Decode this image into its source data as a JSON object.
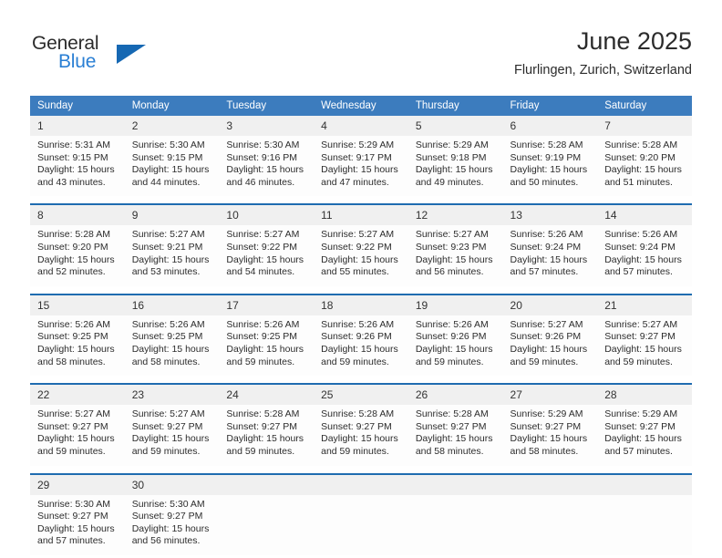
{
  "brand": {
    "name_part1": "General",
    "name_part2": "Blue",
    "logo_icon": "triangle-icon"
  },
  "header": {
    "title": "June 2025",
    "subtitle": "Flurlingen, Zurich, Switzerland"
  },
  "colors": {
    "header_blue": "#3c7cbe",
    "separator_blue": "#1f6cb0",
    "daynum_band": "#f0f0f0",
    "brand_blue": "#2a7fd4",
    "text": "#2c2c2c"
  },
  "day_headers": [
    "Sunday",
    "Monday",
    "Tuesday",
    "Wednesday",
    "Thursday",
    "Friday",
    "Saturday"
  ],
  "weeks": [
    {
      "days": [
        {
          "num": "1",
          "sunrise": "Sunrise: 5:31 AM",
          "sunset": "Sunset: 9:15 PM",
          "daylight_1": "Daylight: 15 hours",
          "daylight_2": "and 43 minutes."
        },
        {
          "num": "2",
          "sunrise": "Sunrise: 5:30 AM",
          "sunset": "Sunset: 9:15 PM",
          "daylight_1": "Daylight: 15 hours",
          "daylight_2": "and 44 minutes."
        },
        {
          "num": "3",
          "sunrise": "Sunrise: 5:30 AM",
          "sunset": "Sunset: 9:16 PM",
          "daylight_1": "Daylight: 15 hours",
          "daylight_2": "and 46 minutes."
        },
        {
          "num": "4",
          "sunrise": "Sunrise: 5:29 AM",
          "sunset": "Sunset: 9:17 PM",
          "daylight_1": "Daylight: 15 hours",
          "daylight_2": "and 47 minutes."
        },
        {
          "num": "5",
          "sunrise": "Sunrise: 5:29 AM",
          "sunset": "Sunset: 9:18 PM",
          "daylight_1": "Daylight: 15 hours",
          "daylight_2": "and 49 minutes."
        },
        {
          "num": "6",
          "sunrise": "Sunrise: 5:28 AM",
          "sunset": "Sunset: 9:19 PM",
          "daylight_1": "Daylight: 15 hours",
          "daylight_2": "and 50 minutes."
        },
        {
          "num": "7",
          "sunrise": "Sunrise: 5:28 AM",
          "sunset": "Sunset: 9:20 PM",
          "daylight_1": "Daylight: 15 hours",
          "daylight_2": "and 51 minutes."
        }
      ]
    },
    {
      "days": [
        {
          "num": "8",
          "sunrise": "Sunrise: 5:28 AM",
          "sunset": "Sunset: 9:20 PM",
          "daylight_1": "Daylight: 15 hours",
          "daylight_2": "and 52 minutes."
        },
        {
          "num": "9",
          "sunrise": "Sunrise: 5:27 AM",
          "sunset": "Sunset: 9:21 PM",
          "daylight_1": "Daylight: 15 hours",
          "daylight_2": "and 53 minutes."
        },
        {
          "num": "10",
          "sunrise": "Sunrise: 5:27 AM",
          "sunset": "Sunset: 9:22 PM",
          "daylight_1": "Daylight: 15 hours",
          "daylight_2": "and 54 minutes."
        },
        {
          "num": "11",
          "sunrise": "Sunrise: 5:27 AM",
          "sunset": "Sunset: 9:22 PM",
          "daylight_1": "Daylight: 15 hours",
          "daylight_2": "and 55 minutes."
        },
        {
          "num": "12",
          "sunrise": "Sunrise: 5:27 AM",
          "sunset": "Sunset: 9:23 PM",
          "daylight_1": "Daylight: 15 hours",
          "daylight_2": "and 56 minutes."
        },
        {
          "num": "13",
          "sunrise": "Sunrise: 5:26 AM",
          "sunset": "Sunset: 9:24 PM",
          "daylight_1": "Daylight: 15 hours",
          "daylight_2": "and 57 minutes."
        },
        {
          "num": "14",
          "sunrise": "Sunrise: 5:26 AM",
          "sunset": "Sunset: 9:24 PM",
          "daylight_1": "Daylight: 15 hours",
          "daylight_2": "and 57 minutes."
        }
      ]
    },
    {
      "days": [
        {
          "num": "15",
          "sunrise": "Sunrise: 5:26 AM",
          "sunset": "Sunset: 9:25 PM",
          "daylight_1": "Daylight: 15 hours",
          "daylight_2": "and 58 minutes."
        },
        {
          "num": "16",
          "sunrise": "Sunrise: 5:26 AM",
          "sunset": "Sunset: 9:25 PM",
          "daylight_1": "Daylight: 15 hours",
          "daylight_2": "and 58 minutes."
        },
        {
          "num": "17",
          "sunrise": "Sunrise: 5:26 AM",
          "sunset": "Sunset: 9:25 PM",
          "daylight_1": "Daylight: 15 hours",
          "daylight_2": "and 59 minutes."
        },
        {
          "num": "18",
          "sunrise": "Sunrise: 5:26 AM",
          "sunset": "Sunset: 9:26 PM",
          "daylight_1": "Daylight: 15 hours",
          "daylight_2": "and 59 minutes."
        },
        {
          "num": "19",
          "sunrise": "Sunrise: 5:26 AM",
          "sunset": "Sunset: 9:26 PM",
          "daylight_1": "Daylight: 15 hours",
          "daylight_2": "and 59 minutes."
        },
        {
          "num": "20",
          "sunrise": "Sunrise: 5:27 AM",
          "sunset": "Sunset: 9:26 PM",
          "daylight_1": "Daylight: 15 hours",
          "daylight_2": "and 59 minutes."
        },
        {
          "num": "21",
          "sunrise": "Sunrise: 5:27 AM",
          "sunset": "Sunset: 9:27 PM",
          "daylight_1": "Daylight: 15 hours",
          "daylight_2": "and 59 minutes."
        }
      ]
    },
    {
      "days": [
        {
          "num": "22",
          "sunrise": "Sunrise: 5:27 AM",
          "sunset": "Sunset: 9:27 PM",
          "daylight_1": "Daylight: 15 hours",
          "daylight_2": "and 59 minutes."
        },
        {
          "num": "23",
          "sunrise": "Sunrise: 5:27 AM",
          "sunset": "Sunset: 9:27 PM",
          "daylight_1": "Daylight: 15 hours",
          "daylight_2": "and 59 minutes."
        },
        {
          "num": "24",
          "sunrise": "Sunrise: 5:28 AM",
          "sunset": "Sunset: 9:27 PM",
          "daylight_1": "Daylight: 15 hours",
          "daylight_2": "and 59 minutes."
        },
        {
          "num": "25",
          "sunrise": "Sunrise: 5:28 AM",
          "sunset": "Sunset: 9:27 PM",
          "daylight_1": "Daylight: 15 hours",
          "daylight_2": "and 59 minutes."
        },
        {
          "num": "26",
          "sunrise": "Sunrise: 5:28 AM",
          "sunset": "Sunset: 9:27 PM",
          "daylight_1": "Daylight: 15 hours",
          "daylight_2": "and 58 minutes."
        },
        {
          "num": "27",
          "sunrise": "Sunrise: 5:29 AM",
          "sunset": "Sunset: 9:27 PM",
          "daylight_1": "Daylight: 15 hours",
          "daylight_2": "and 58 minutes."
        },
        {
          "num": "28",
          "sunrise": "Sunrise: 5:29 AM",
          "sunset": "Sunset: 9:27 PM",
          "daylight_1": "Daylight: 15 hours",
          "daylight_2": "and 57 minutes."
        }
      ]
    },
    {
      "days": [
        {
          "num": "29",
          "sunrise": "Sunrise: 5:30 AM",
          "sunset": "Sunset: 9:27 PM",
          "daylight_1": "Daylight: 15 hours",
          "daylight_2": "and 57 minutes."
        },
        {
          "num": "30",
          "sunrise": "Sunrise: 5:30 AM",
          "sunset": "Sunset: 9:27 PM",
          "daylight_1": "Daylight: 15 hours",
          "daylight_2": "and 56 minutes."
        },
        {
          "num": "",
          "sunrise": "",
          "sunset": "",
          "daylight_1": "",
          "daylight_2": ""
        },
        {
          "num": "",
          "sunrise": "",
          "sunset": "",
          "daylight_1": "",
          "daylight_2": ""
        },
        {
          "num": "",
          "sunrise": "",
          "sunset": "",
          "daylight_1": "",
          "daylight_2": ""
        },
        {
          "num": "",
          "sunrise": "",
          "sunset": "",
          "daylight_1": "",
          "daylight_2": ""
        },
        {
          "num": "",
          "sunrise": "",
          "sunset": "",
          "daylight_1": "",
          "daylight_2": ""
        }
      ]
    }
  ]
}
